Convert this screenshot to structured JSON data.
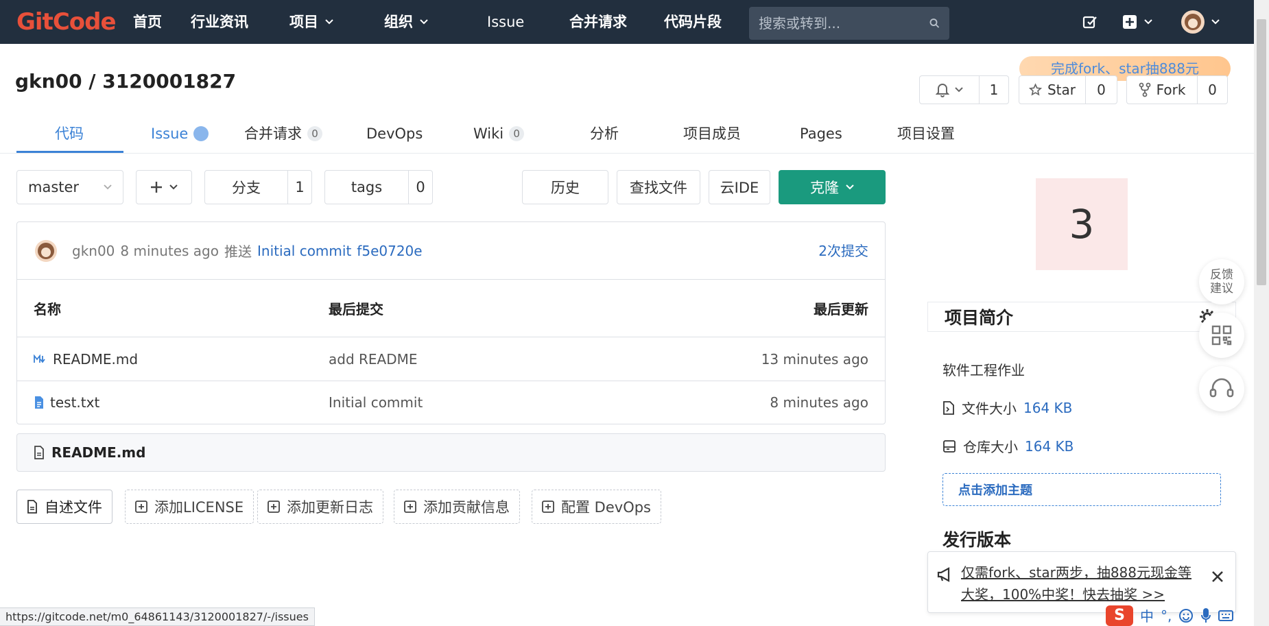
{
  "nav": {
    "logo": "GitCode",
    "items": [
      {
        "label": "首页"
      },
      {
        "label": "行业资讯"
      },
      {
        "label": "项目"
      },
      {
        "label": "组织"
      },
      {
        "label": "Issue"
      },
      {
        "label": "合并请求"
      },
      {
        "label": "代码片段"
      }
    ],
    "search_placeholder": "搜索或转到..."
  },
  "project": {
    "title": "gkn00 / 3120001827",
    "promo": "完成fork、star抽888元",
    "watch_count": "1",
    "star_label": "Star",
    "star_count": "0",
    "fork_label": "Fork",
    "fork_count": "0"
  },
  "tabs": [
    {
      "label": "代码"
    },
    {
      "label": "Issue"
    },
    {
      "label": "合并请求",
      "badge": "0"
    },
    {
      "label": "DevOps"
    },
    {
      "label": "Wiki",
      "badge": "0"
    },
    {
      "label": "分析"
    },
    {
      "label": "项目成员"
    },
    {
      "label": "Pages"
    },
    {
      "label": "项目设置"
    }
  ],
  "toolbar": {
    "branch": "master",
    "branches_label": "分支",
    "branches_count": "1",
    "tags_label": "tags",
    "tags_count": "0",
    "history": "历史",
    "find_file": "查找文件",
    "cloud_ide": "云IDE",
    "clone": "克隆"
  },
  "commit": {
    "author": "gkn00",
    "time": "8 minutes ago",
    "action": "推送",
    "message": "Initial commit",
    "sha": "f5e0720e",
    "count_link": "2次提交"
  },
  "table": {
    "headers": [
      "名称",
      "最后提交",
      "最后更新"
    ],
    "rows": [
      {
        "name": "README.md",
        "commit": "add README",
        "updated": "13 minutes ago"
      },
      {
        "name": "test.txt",
        "commit": "Initial commit",
        "updated": "8 minutes ago"
      }
    ]
  },
  "readme_title": "README.md",
  "quick_actions": [
    "自述文件",
    "添加LICENSE",
    "添加更新日志",
    "添加贡献信息",
    "配置 DevOps"
  ],
  "sidebar": {
    "counter": "3",
    "intro_title": "项目简介",
    "description": "软件工程作业",
    "file_size_label": "文件大小",
    "file_size": "164 KB",
    "repo_size_label": "仓库大小",
    "repo_size": "164 KB",
    "add_topic": "点击添加主题",
    "releases_title": "发行版本"
  },
  "floating": {
    "feedback": "反馈\n建议"
  },
  "notice": {
    "message": "仅需fork、star两步，抽888元现金等大奖，100%中奖！快去抽奖 >>"
  },
  "status_url": "https://gitcode.net/m0_64861143/3120001827/-/issues",
  "ime": {
    "mode": "中",
    "punct": "°,"
  },
  "colors": {
    "nav_bg": "#222f3e",
    "accent": "#3b82d6",
    "clone": "#1a9a7e",
    "logo": "#e8503a"
  }
}
